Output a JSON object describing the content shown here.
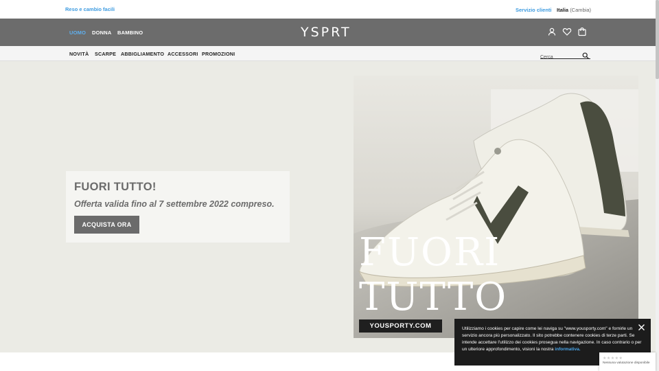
{
  "topbar": {
    "easy_returns": "Reso e cambio facili",
    "customer_service": "Servizio clienti",
    "country": "Italia",
    "change": "(Cambia)"
  },
  "header": {
    "logo": "YSPRT",
    "genders": [
      "UOMO",
      "DONNA",
      "BAMBINO"
    ],
    "active_gender": "UOMO",
    "icons": [
      "user-icon",
      "heart-icon",
      "cart-icon"
    ]
  },
  "nav": {
    "categories": [
      "NOVITÀ",
      "SCARPE",
      "ABBIGLIAMENTO",
      "ACCESSORI",
      "PROMOZIONI"
    ],
    "search_placeholder": "Cerca"
  },
  "hero": {
    "title": "FUORI TUTTO!",
    "subtitle": "Offerta valida fino al 7 settembre 2022 compreso.",
    "cta": "ACQUISTA ORA",
    "image_text_line1": "FUORI",
    "image_text_line2": "TUTTO",
    "image_site": "YOUSPORTY.COM"
  },
  "cookie": {
    "text": "Utilizziamo i cookies per capire come lei naviga su \"www.yousporty.com\" e fornirle un servizio ancora più personalizzato. Il sito potrebbe contenere cookies di terze parti. Se intende accettare l'utilizzo dei cookies prosegua nella navigazione. In caso contrario o per un ulteriore approfondimento, visioni la nostra ",
    "link": "informativa."
  },
  "rating": {
    "stars": "★★★★★",
    "text": "Nessuna valutazione disponibile"
  },
  "colors": {
    "accent_blue": "#3d9be0",
    "header_grey": "#6c6c6c",
    "hero_bg": "#ebebe5",
    "button_grey": "#6b6b6b"
  }
}
